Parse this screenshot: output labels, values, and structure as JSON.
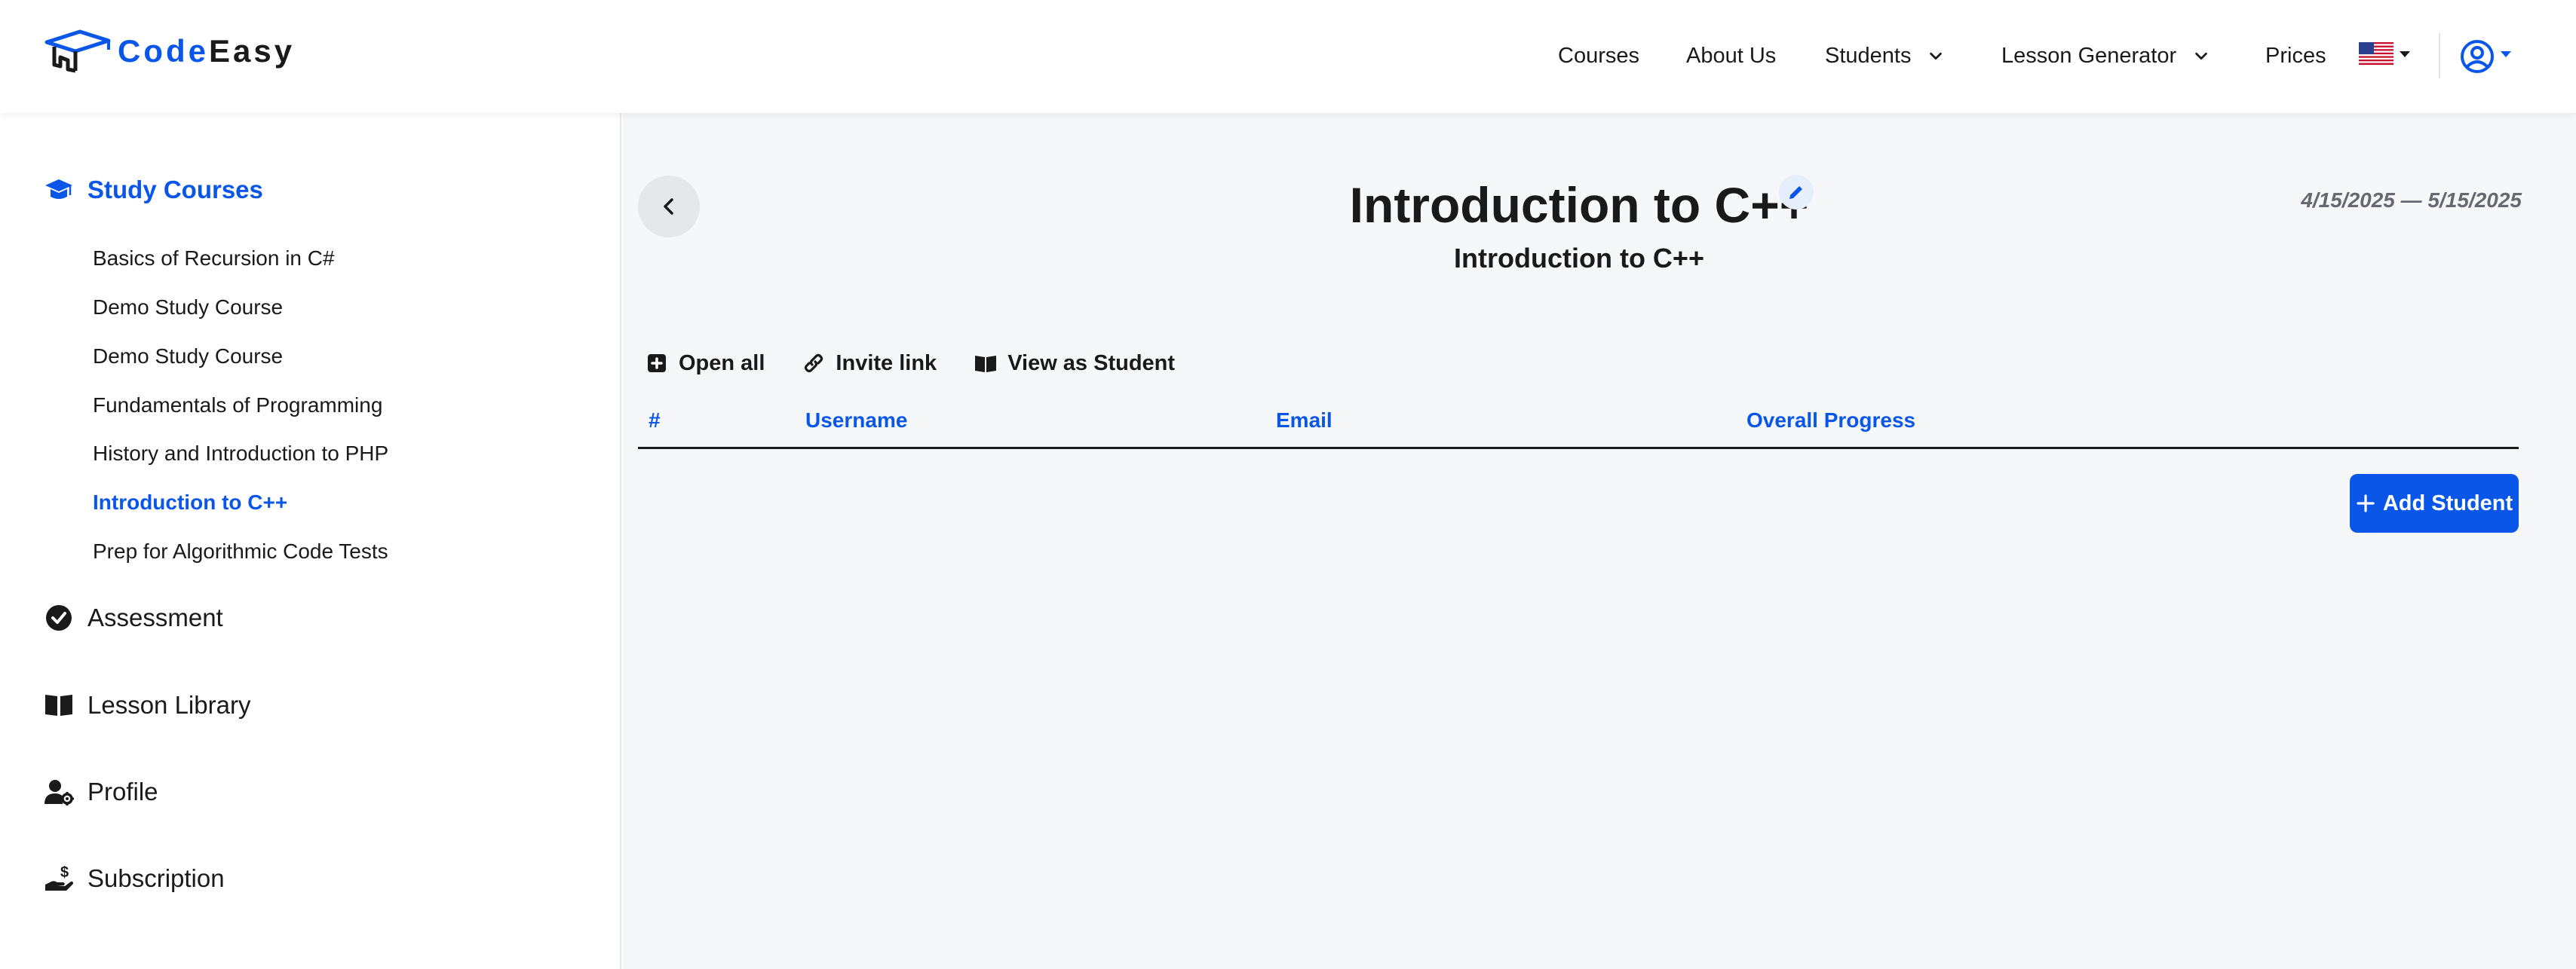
{
  "header": {
    "logo": {
      "part1": "Code",
      "part2": "Easy"
    },
    "nav": {
      "courses": "Courses",
      "about": "About Us",
      "students": "Students",
      "lesson_generator": "Lesson Generator",
      "prices": "Prices"
    },
    "language_flag": "us-flag-icon",
    "account_icon": "user-circle-icon"
  },
  "sidebar": {
    "study_courses": "Study Courses",
    "courses": [
      "Basics of Recursion in C#",
      "Demo Study Course",
      "Demo Study Course",
      "Fundamentals of Programming",
      "History and Introduction to PHP",
      "Introduction to C++",
      "Prep for Algorithmic Code Tests"
    ],
    "active_course_index": 5,
    "assessment": "Assessment",
    "lesson_library": "Lesson Library",
    "profile": "Profile",
    "subscription": "Subscription"
  },
  "main": {
    "title": "Introduction to C++",
    "subtitle": "Introduction to C++",
    "date_range": "4/15/2025 — 5/15/2025",
    "actions": {
      "open_all": "Open all",
      "invite_link": "Invite link",
      "view_as_student": "View as Student"
    },
    "table": {
      "columns": [
        "#",
        "Username",
        "Email",
        "Overall Progress"
      ],
      "rows": []
    },
    "add_student": "Add Student"
  },
  "colors": {
    "accent": "#0a56e8",
    "text": "#1a1a1a",
    "main_bg": "#f6f7f9",
    "date_text": "#666a70"
  }
}
